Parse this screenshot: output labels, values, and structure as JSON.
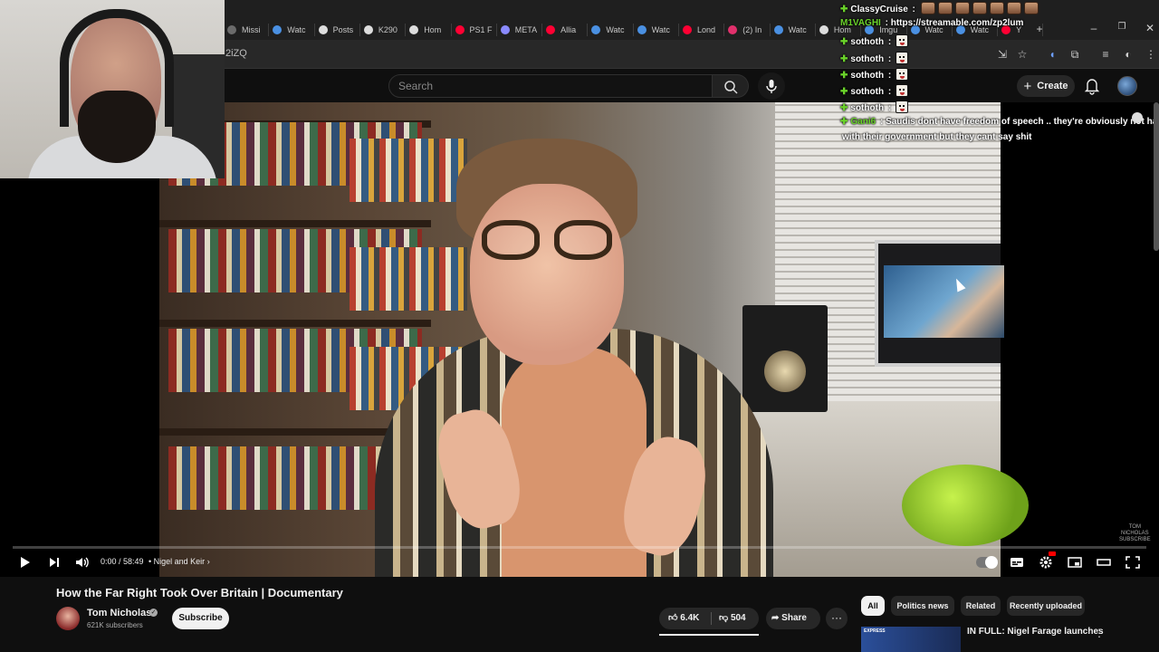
{
  "browser": {
    "tabs": [
      {
        "label": "Missi",
        "icon": "page-icon",
        "color": "#6b6b6b"
      },
      {
        "label": "Watc",
        "icon": "globe-icon",
        "color": "#4a90e2"
      },
      {
        "label": "Posts",
        "icon": "x-icon",
        "color": "#dddddd"
      },
      {
        "label": "K290",
        "icon": "x-icon",
        "color": "#dddddd"
      },
      {
        "label": "Hom",
        "icon": "x-icon",
        "color": "#dddddd"
      },
      {
        "label": "PS1 F",
        "icon": "youtube-icon",
        "color": "#ff0033"
      },
      {
        "label": "META",
        "icon": "meta-icon",
        "color": "#8a8aff"
      },
      {
        "label": "Allia",
        "icon": "youtube-icon",
        "color": "#ff0033"
      },
      {
        "label": "Watc",
        "icon": "globe-icon",
        "color": "#4a90e2"
      },
      {
        "label": "Watc",
        "icon": "globe-icon",
        "color": "#4a90e2"
      },
      {
        "label": "Lond",
        "icon": "youtube-icon",
        "color": "#ff0033"
      },
      {
        "label": "(2) In",
        "icon": "instagram-icon",
        "color": "#e1306c"
      },
      {
        "label": "Watc",
        "icon": "globe-icon",
        "color": "#4a90e2"
      },
      {
        "label": "Hom",
        "icon": "x-icon",
        "color": "#dddddd"
      },
      {
        "label": "Imgu",
        "icon": "globe-icon",
        "color": "#4a90e2"
      },
      {
        "label": "Watc",
        "icon": "globe-icon",
        "color": "#4a90e2"
      },
      {
        "label": "Watc",
        "icon": "globe-icon",
        "color": "#4a90e2"
      },
      {
        "label": "Y",
        "icon": "youtube-icon",
        "color": "#ff0033"
      }
    ],
    "url_fragment": "2iZQ"
  },
  "youtube": {
    "search_placeholder": "Search",
    "create_label": "Create"
  },
  "chat": {
    "messages": [
      {
        "user": "ClassyCruise",
        "user_color": "#ffffff",
        "badge": true,
        "text": "",
        "emotes": "face",
        "emote_count": 7
      },
      {
        "user": "M1VAGHI",
        "user_color": "#6ad22a",
        "badge": false,
        "text": "https://streamable.com/zp2lum",
        "emotes": "",
        "emote_count": 0
      },
      {
        "user": "sothoth",
        "user_color": "#ffffff",
        "badge": true,
        "text": "",
        "emotes": "scream",
        "emote_count": 1
      },
      {
        "user": "sothoth",
        "user_color": "#ffffff",
        "badge": true,
        "text": "",
        "emotes": "scream",
        "emote_count": 1
      },
      {
        "user": "sothoth",
        "user_color": "#ffffff",
        "badge": true,
        "text": "",
        "emotes": "scream",
        "emote_count": 1
      },
      {
        "user": "sothoth",
        "user_color": "#ffffff",
        "badge": true,
        "text": "",
        "emotes": "scream",
        "emote_count": 1
      },
      {
        "user": "sothoth",
        "user_color": "#ffffff",
        "badge": true,
        "text": "",
        "emotes": "scream",
        "emote_count": 1
      },
      {
        "user": "Gani6",
        "user_color": "#6ad22a",
        "badge": true,
        "text": "Saudis dont have freedom of speech .. they're obviously not happy",
        "emotes": "",
        "emote_count": 0
      }
    ],
    "continuation": "with their government but they cant say shit"
  },
  "player": {
    "time": "0:00 / 58:49",
    "chapter": "• Nigel and Keir",
    "progress": 0
  },
  "video": {
    "title": "How the Far Right Took Over Britain | Documentary",
    "channel": "Tom Nicholas",
    "subscribers": "621K subscribers",
    "subscribe_label": "Subscribe",
    "likes": "6.4K",
    "dislikes": "504",
    "share_label": "Share"
  },
  "related": {
    "chips": [
      "All",
      "Politics news",
      "Related",
      "Recently uploaded"
    ],
    "active_chip": "All",
    "first_title": "IN FULL: Nigel Farage launches",
    "first_thumb_text": "EXPRESS"
  },
  "colors": {
    "background": "#0f0f0f",
    "chat_badge": "#6ad22a",
    "youtube_red": "#ff0033"
  }
}
